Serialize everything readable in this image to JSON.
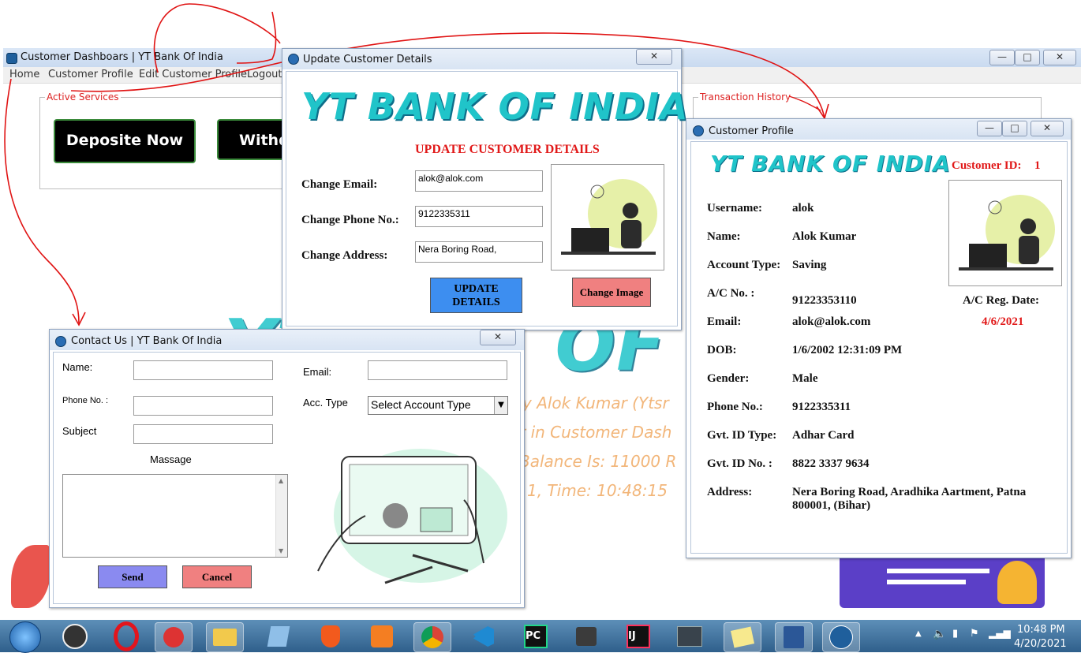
{
  "main_window": {
    "title": "Customer Dashboars | YT Bank Of India",
    "menu": [
      "Home",
      "Customer Profile",
      "Edit Customer Profile",
      "Logout"
    ],
    "active_services_label": "Active Services",
    "transaction_history_label": "Transaction History",
    "service_buttons": [
      "Deposite Now",
      "Withdr"
    ],
    "watermark_lines": [
      "y Alok Kumar (Ytsr",
      "r in Customer Dash",
      "Balance Is: 11000 R",
      "1, Time: 10:48:15"
    ]
  },
  "update_dialog": {
    "title": "Update Customer Details",
    "close": "✕",
    "logo": "YT BANK OF INDIA",
    "heading": "UPDATE CUSTOMER DETAILS",
    "email_label": "Change Email:",
    "email_value": "alok@alok.com",
    "phone_label": "Change Phone No.:",
    "phone_value": "9122335311",
    "address_label": "Change Address:",
    "address_value": "Nera Boring Road,",
    "update_button": "UPDATE DETAILS",
    "change_image_button": "Change Image"
  },
  "profile_dialog": {
    "title": "Customer Profile",
    "logo": "YT BANK OF INDIA",
    "customer_id_label": "Customer ID:",
    "customer_id": "1",
    "reg_date_label": "A/C Reg. Date:",
    "reg_date": "4/6/2021",
    "fields": [
      {
        "label": "Username:",
        "value": "alok"
      },
      {
        "label": "Name:",
        "value": "Alok Kumar"
      },
      {
        "label": "Account Type:",
        "value": "Saving"
      },
      {
        "label": "A/C No. :",
        "value": "91223353110"
      },
      {
        "label": "Email:",
        "value": "alok@alok.com"
      },
      {
        "label": "DOB:",
        "value": "1/6/2002 12:31:09 PM"
      },
      {
        "label": "Gender:",
        "value": "Male"
      },
      {
        "label": "Phone No.:",
        "value": "9122335311"
      },
      {
        "label": "Gvt. ID Type:",
        "value": "Adhar Card"
      },
      {
        "label": "Gvt. ID No. :",
        "value": "8822 3337 9634"
      },
      {
        "label": "Address:",
        "value": "Nera Boring Road, Aradhika Aartment, Patna 800001, (Bihar)"
      }
    ]
  },
  "contact_dialog": {
    "title": "Contact Us | YT Bank Of India",
    "name_label": "Name:",
    "phone_label": "Phone No. :",
    "subject_label": "Subject",
    "email_label": "Email:",
    "acc_type_label": "Acc. Type",
    "acc_type_selected": "Select Account Type",
    "message_label": "Massage",
    "send_button": "Send",
    "cancel_button": "Cancel"
  },
  "taskbar": {
    "time": "10:48 PM",
    "date": "4/20/2021"
  },
  "colors": {
    "red_heading": "#e11919",
    "logo_cyan": "#20c4c9",
    "update_button": "#3d8ef0",
    "change_image_button": "#f08080",
    "send_button": "#8a8af0",
    "cancel_button": "#f08080"
  }
}
